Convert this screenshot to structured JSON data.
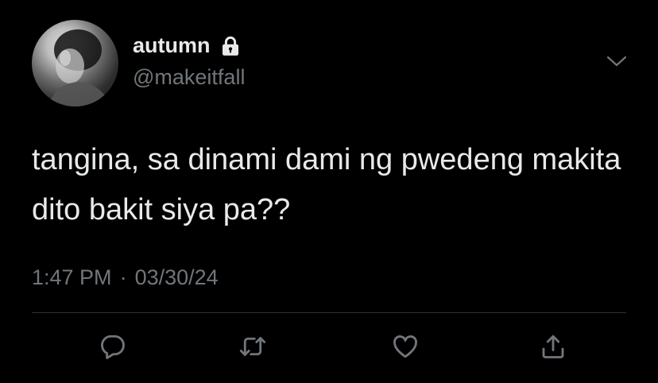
{
  "user": {
    "display_name": "autumn",
    "handle": "@makeitfall",
    "protected_icon": "lock-icon",
    "avatar": "profile-photo"
  },
  "tweet": {
    "text": "tangina, sa dinami dami ng pwedeng makita dito bakit siya pa??",
    "time": "1:47 PM",
    "separator": "·",
    "date": "03/30/24"
  },
  "menu": {
    "icon": "chevron-down-icon"
  },
  "actions": [
    {
      "icon": "reply-icon"
    },
    {
      "icon": "retweet-icon"
    },
    {
      "icon": "like-icon"
    },
    {
      "icon": "share-icon"
    }
  ],
  "colors": {
    "background": "#000000",
    "primary_text": "#e7e9ea",
    "secondary_text": "#71767b",
    "divider": "#2f3336"
  }
}
